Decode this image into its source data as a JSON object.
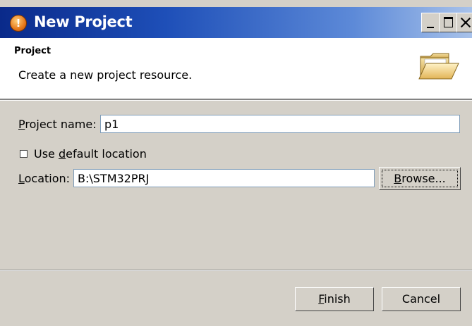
{
  "window": {
    "title": "New Project"
  },
  "banner": {
    "title": "Project",
    "description": "Create a new project resource."
  },
  "form": {
    "project_name_label_mn": "P",
    "project_name_label_rest": "roject name:",
    "project_name_value": "p1",
    "default_location_pre": "Use ",
    "default_location_mn": "d",
    "default_location_rest": "efault location",
    "default_location_checked": false,
    "location_label_mn": "L",
    "location_label_rest": "ocation:",
    "location_value": "B:\\STM32PRJ",
    "browse_mn": "B",
    "browse_rest": "rowse..."
  },
  "footer": {
    "finish_mn": "F",
    "finish_rest": "inish",
    "cancel_label": "Cancel"
  },
  "icons": {
    "app": "app-icon",
    "folder": "open-folder-icon",
    "minimize": "minimize-icon",
    "maximize": "maximize-icon",
    "close": "close-icon"
  }
}
